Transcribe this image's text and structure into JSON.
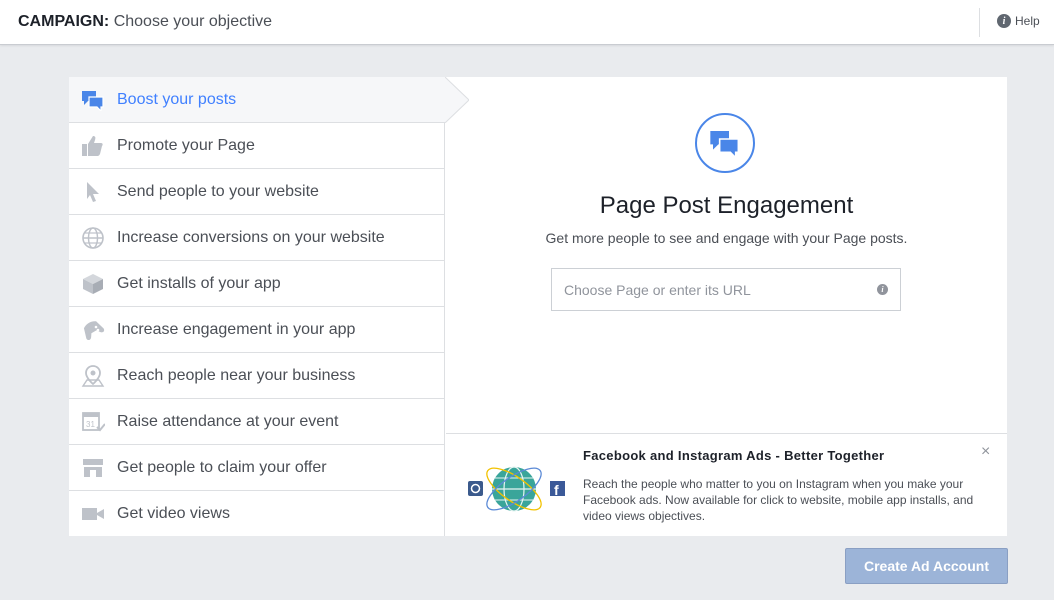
{
  "header": {
    "campaign_label": "CAMPAIGN:",
    "subtitle": "Choose your objective",
    "help_label": "Help",
    "help_icon": "info-circle-icon"
  },
  "objectives": [
    {
      "label": "Boost your posts",
      "icon": "speech-bubbles-icon",
      "active": true
    },
    {
      "label": "Promote your Page",
      "icon": "thumbs-up-icon"
    },
    {
      "label": "Send people to your website",
      "icon": "cursor-icon"
    },
    {
      "label": "Increase conversions on your website",
      "icon": "globe-icon"
    },
    {
      "label": "Get installs of your app",
      "icon": "box-icon"
    },
    {
      "label": "Increase engagement in your app",
      "icon": "gamepad-icon"
    },
    {
      "label": "Reach people near your business",
      "icon": "map-pin-icon"
    },
    {
      "label": "Raise attendance at your event",
      "icon": "calendar-icon"
    },
    {
      "label": "Get people to claim your offer",
      "icon": "storefront-icon"
    },
    {
      "label": "Get video views",
      "icon": "video-camera-icon"
    }
  ],
  "detail": {
    "title": "Page Post Engagement",
    "subtitle": "Get more people to see and engage with your Page posts.",
    "page_input_placeholder": "Choose Page or enter its URL",
    "page_input_value": ""
  },
  "promo": {
    "title": "Facebook and Instagram Ads - Better Together",
    "text": "Reach the people who matter to you on Instagram when you make your Facebook ads. Now available for click to website, mobile app installs, and video views objectives.",
    "close_symbol": "×"
  },
  "footer": {
    "create_button_label": "Create Ad Account"
  },
  "colors": {
    "accent": "#4080ff",
    "icon_gray": "#bec2c9",
    "button_disabled": "#9cb4d8",
    "page_background": "#e9ebee"
  }
}
